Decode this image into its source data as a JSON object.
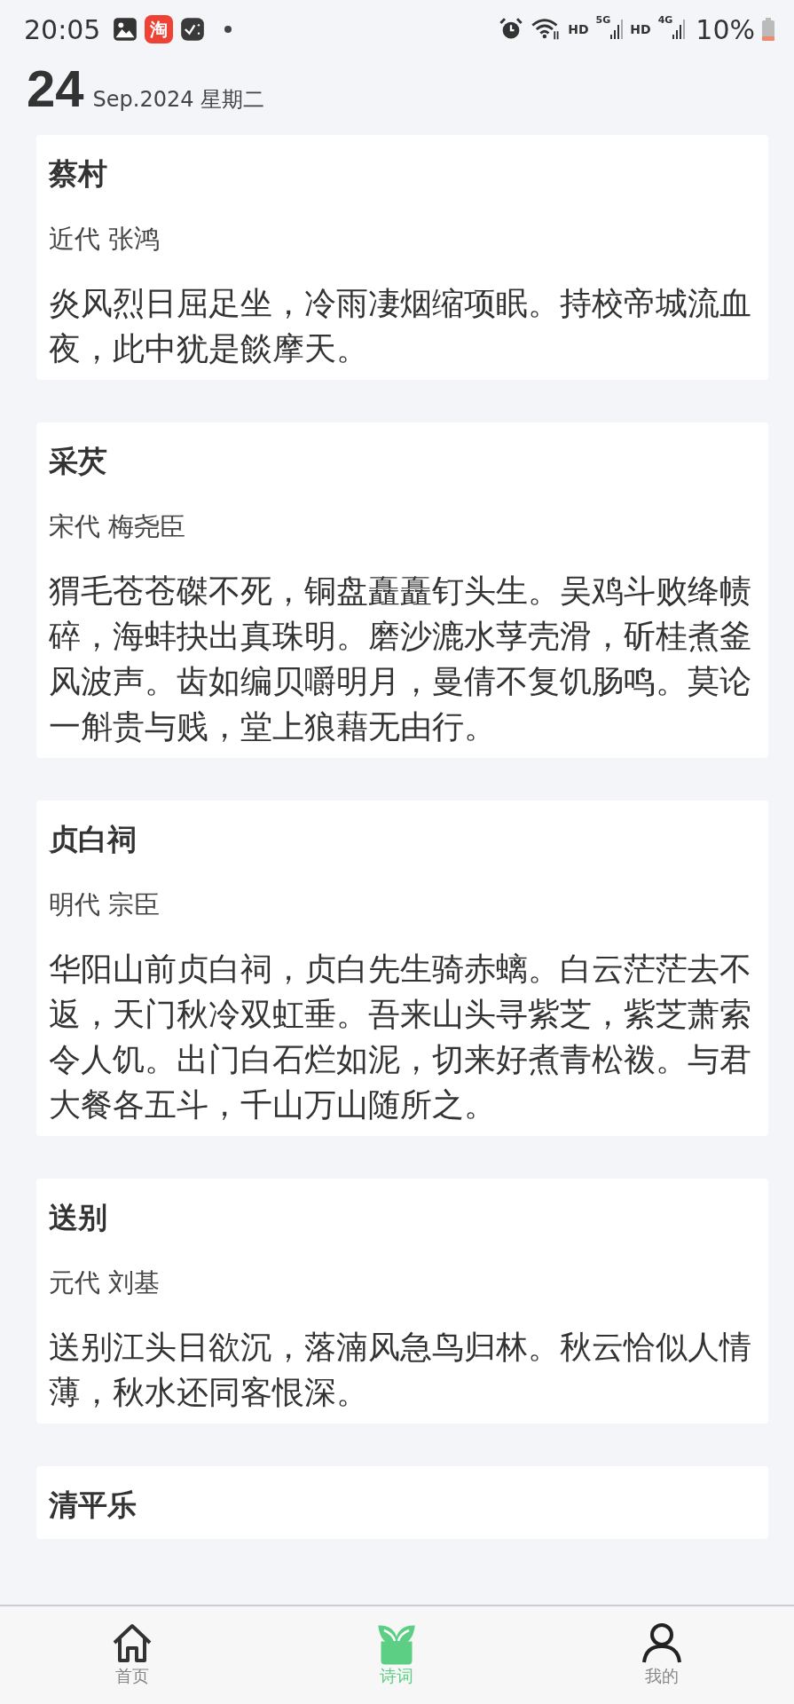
{
  "status_bar": {
    "time": "20:05",
    "app_badge": "淘",
    "network_labels": [
      "HD",
      "5G",
      "HD",
      "4G"
    ],
    "battery": "10%"
  },
  "date": {
    "day": "24",
    "month_year": "Sep.2024",
    "weekday": "星期二"
  },
  "poems": [
    {
      "title": "蔡村",
      "author": "近代 张鸿",
      "text": "炎风烈日屈足坐，冷雨凄烟缩项眠。持校帝城流血夜，此中犹是餤摩天。"
    },
    {
      "title": "采芡",
      "author": "宋代 梅尧臣",
      "text": "猬毛苍苍磔不死，铜盘矗矗钉头生。吴鸡斗败绛帻碎，海蚌抉出真珠明。磨沙漉水莩壳滑，斫桂煮釜风波声。齿如编贝嚼明月，曼倩不复饥肠鸣。莫论一斛贵与贱，堂上狼藉无由行。"
    },
    {
      "title": "贞白祠",
      "author": "明代 宗臣",
      "text": "华阳山前贞白祠，贞白先生骑赤螭。白云茫茫去不返，天门秋冷双虹垂。吾来山头寻紫芝，紫芝萧索令人饥。出门白石烂如泥，切来好煮青松袯。与君大餐各五斗，千山万山随所之。"
    },
    {
      "title": "送别",
      "author": "元代 刘基",
      "text": "送别江头日欲沉，落湳风急鸟归林。秋云恰似人情薄，秋水还同客恨深。"
    },
    {
      "title": "清平乐"
    }
  ],
  "nav": [
    {
      "kind": "home",
      "label": "首页",
      "selected": false
    },
    {
      "kind": "sprout",
      "label": "诗词",
      "selected": true
    },
    {
      "kind": "person",
      "label": "我的",
      "selected": false
    }
  ]
}
